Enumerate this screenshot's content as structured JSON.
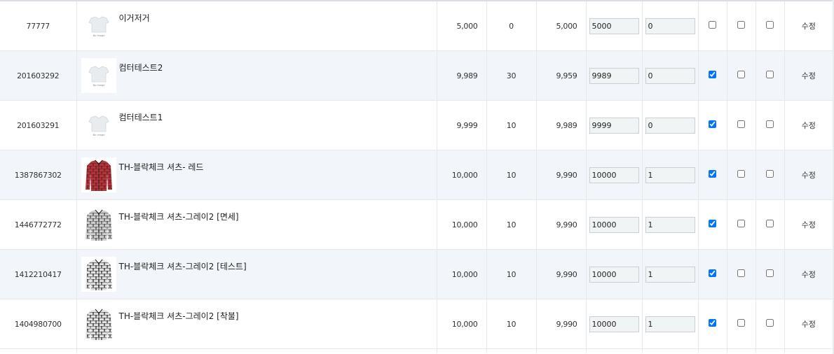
{
  "rows": [
    {
      "code": "77777",
      "name": "이거저거",
      "image": "no-image",
      "price": "5,000",
      "discount": "0",
      "final": "5,000",
      "price_input": "5000",
      "stock_input": "0",
      "chk1": false,
      "chk2": false,
      "chk3": false,
      "edit": "수정",
      "alt": false
    },
    {
      "code": "201603292",
      "name": "컴터테스트2",
      "image": "no-image",
      "price": "9,989",
      "discount": "30",
      "final": "9,959",
      "price_input": "9989",
      "stock_input": "0",
      "chk1": true,
      "chk2": false,
      "chk3": false,
      "edit": "수정",
      "alt": true
    },
    {
      "code": "201603291",
      "name": "컴터테스트1",
      "image": "no-image",
      "price": "9,999",
      "discount": "10",
      "final": "9,989",
      "price_input": "9999",
      "stock_input": "0",
      "chk1": true,
      "chk2": false,
      "chk3": false,
      "edit": "수정",
      "alt": false
    },
    {
      "code": "1387867302",
      "name": "TH-블락체크 셔츠- 레드",
      "image": "shirt-red",
      "price": "10,000",
      "discount": "10",
      "final": "9,990",
      "price_input": "10000",
      "stock_input": "1",
      "chk1": true,
      "chk2": false,
      "chk3": false,
      "edit": "수정",
      "alt": true
    },
    {
      "code": "1446772772",
      "name": "TH-블락체크 셔츠-그레이2 [면세]",
      "image": "shirt-gray",
      "price": "10,000",
      "discount": "10",
      "final": "9,990",
      "price_input": "10000",
      "stock_input": "1",
      "chk1": true,
      "chk2": false,
      "chk3": false,
      "edit": "수정",
      "alt": false
    },
    {
      "code": "1412210417",
      "name": "TH-블락체크 셔츠-그레이2 [테스트]",
      "image": "shirt-black",
      "price": "10,000",
      "discount": "10",
      "final": "9,990",
      "price_input": "10000",
      "stock_input": "1",
      "chk1": true,
      "chk2": false,
      "chk3": false,
      "edit": "수정",
      "alt": true
    },
    {
      "code": "1404980700",
      "name": "TH-블락체크 셔츠-그레이2 [착불]",
      "image": "shirt-black",
      "price": "10,000",
      "discount": "10",
      "final": "9,990",
      "price_input": "10000",
      "stock_input": "1",
      "chk1": true,
      "chk2": false,
      "chk3": false,
      "edit": "수정",
      "alt": false
    }
  ],
  "no_image_text": "No image",
  "colors": {
    "row_alt": "#f2f5f9",
    "border": "#e6e9ec",
    "input_bg": "#f1f4f4"
  }
}
